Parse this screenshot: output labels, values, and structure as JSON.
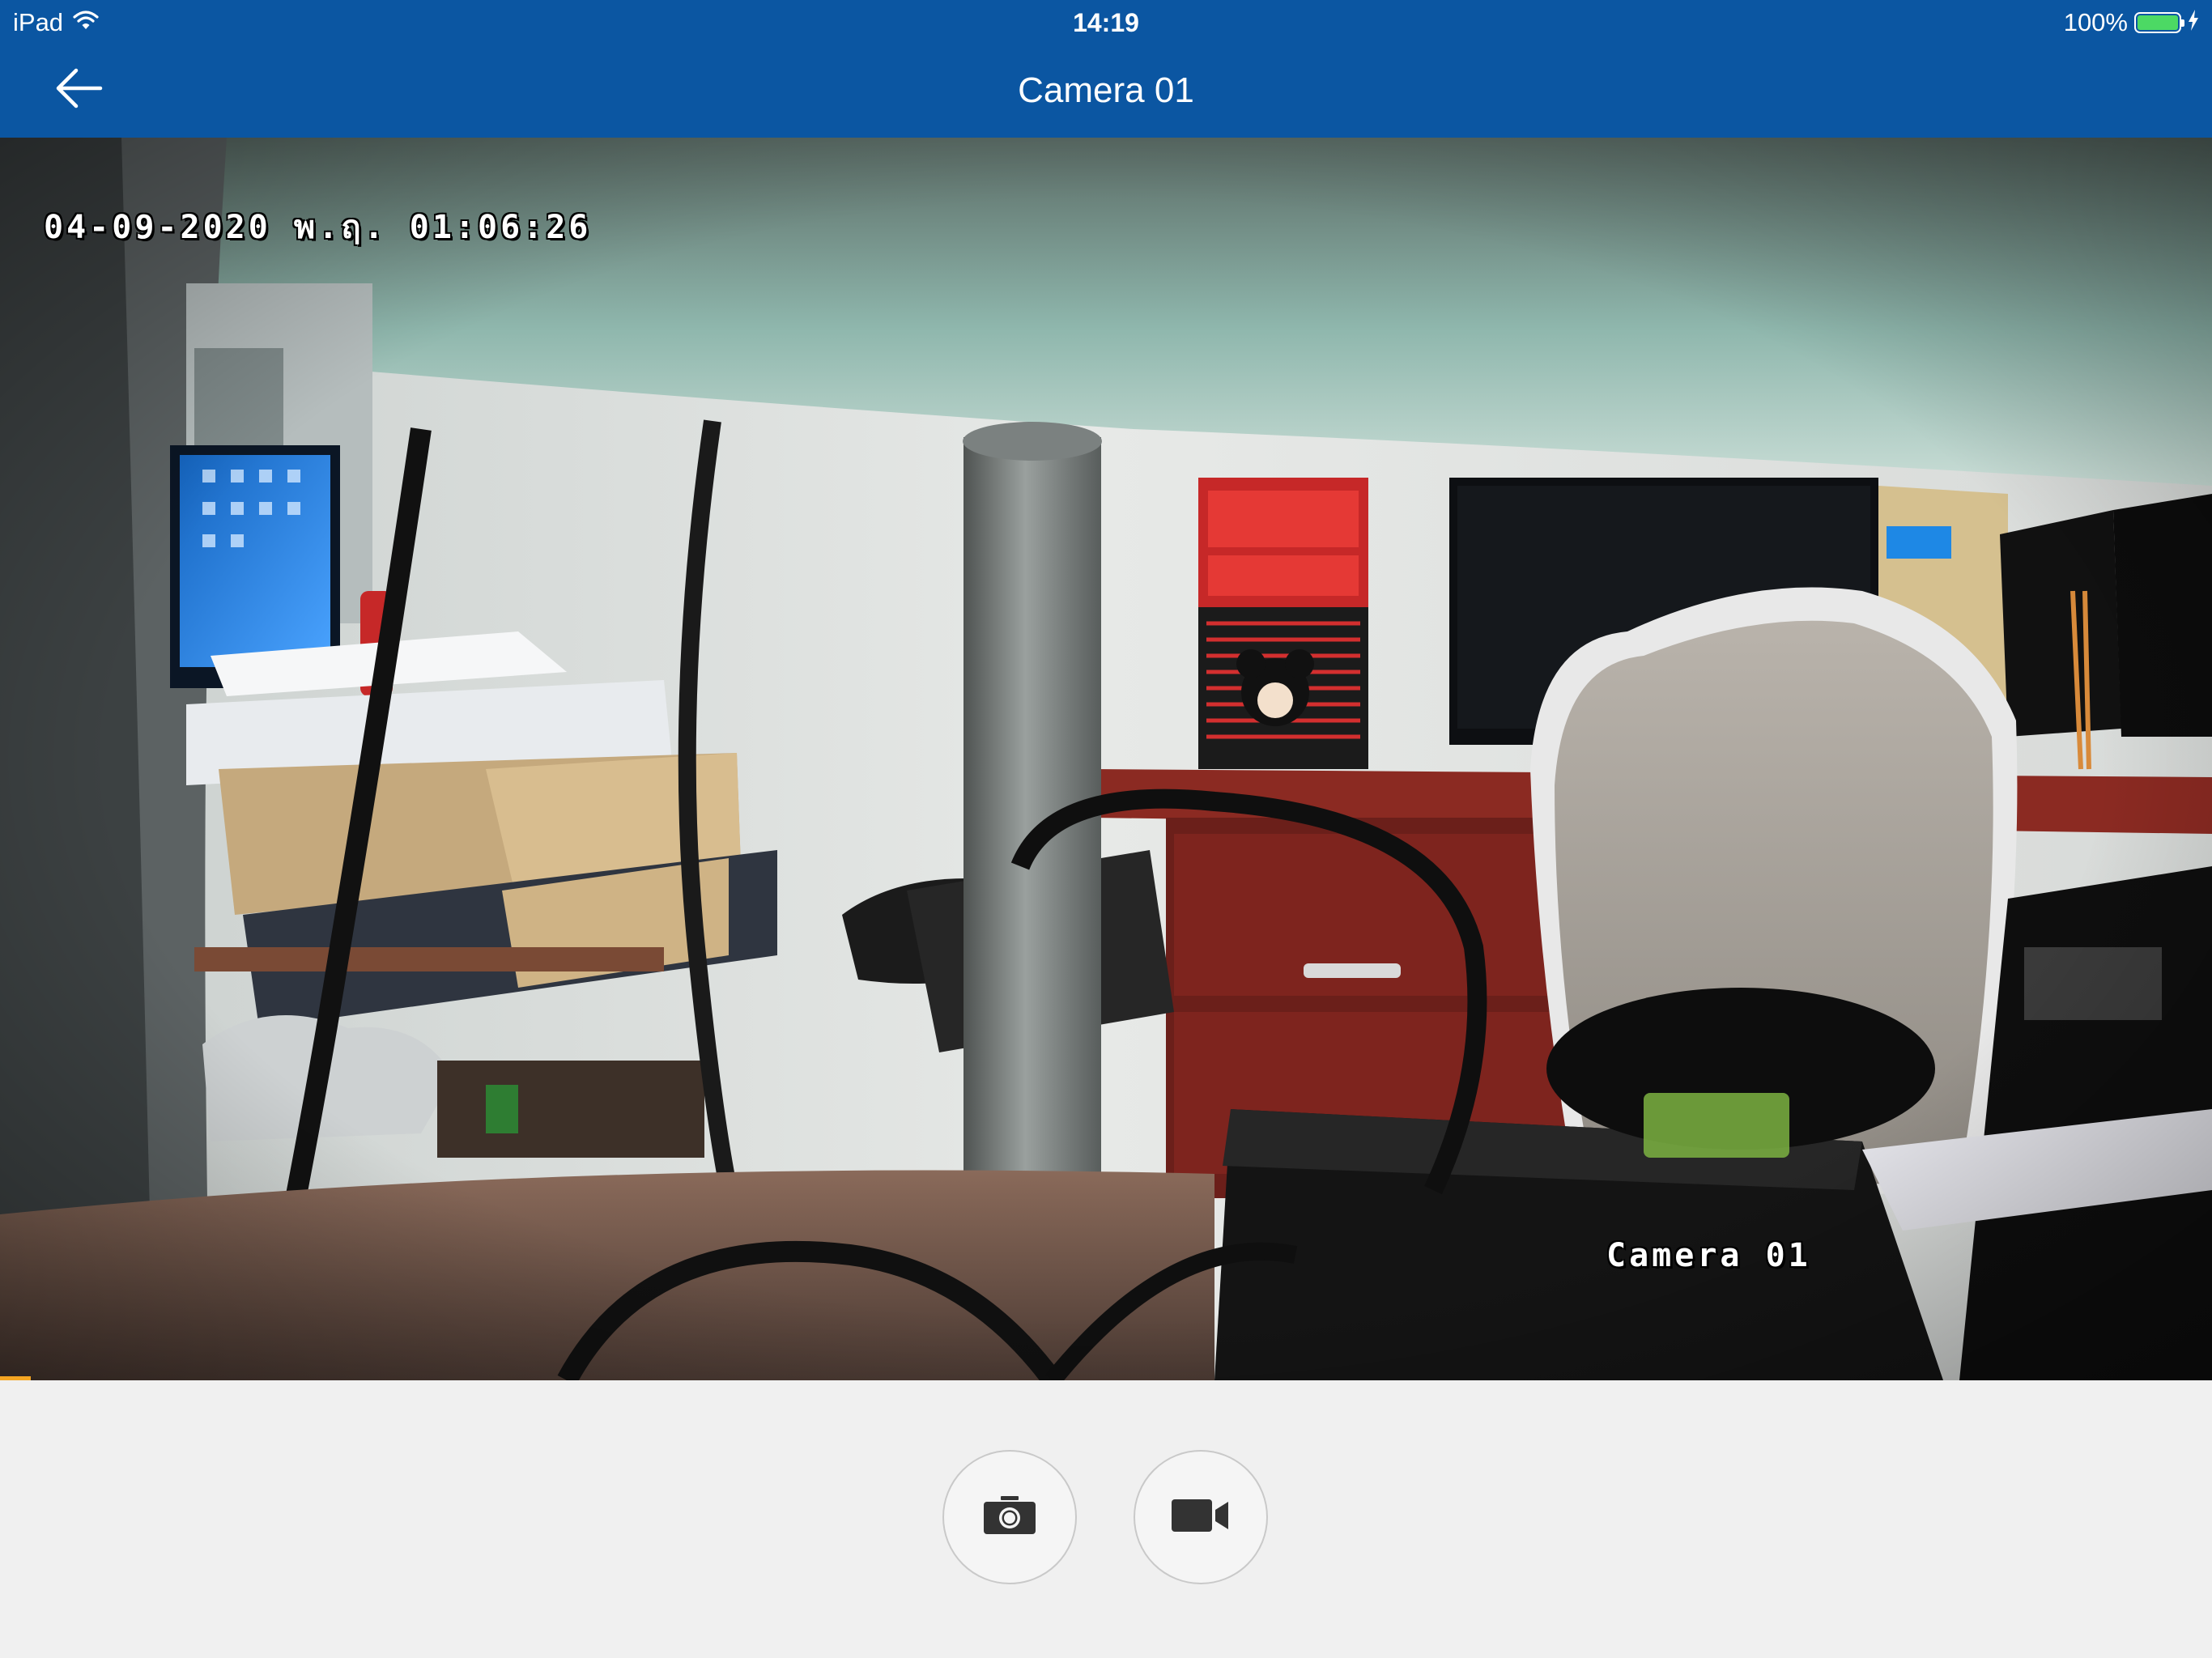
{
  "status_bar": {
    "device": "iPad",
    "time": "14:19",
    "battery_percent": "100%",
    "battery_level": 1.0,
    "wifi_icon": "wifi-icon",
    "charging_icon": "charging-bolt-icon"
  },
  "nav": {
    "title": "Camera 01",
    "back_icon": "arrow-left-icon"
  },
  "video": {
    "osd_datetime": "04-09-2020 พ.ฤ. 01:06:26",
    "osd_camera_name": "Camera 01",
    "playback_progress": 0.014
  },
  "controls": {
    "snapshot_icon": "camera-icon",
    "record_icon": "video-camera-icon"
  },
  "colors": {
    "header_blue": "#0b56a2",
    "progress_orange": "#f5a623",
    "battery_green": "#4cd964",
    "background": "#f0f0f0",
    "icon_dark": "#333333"
  }
}
